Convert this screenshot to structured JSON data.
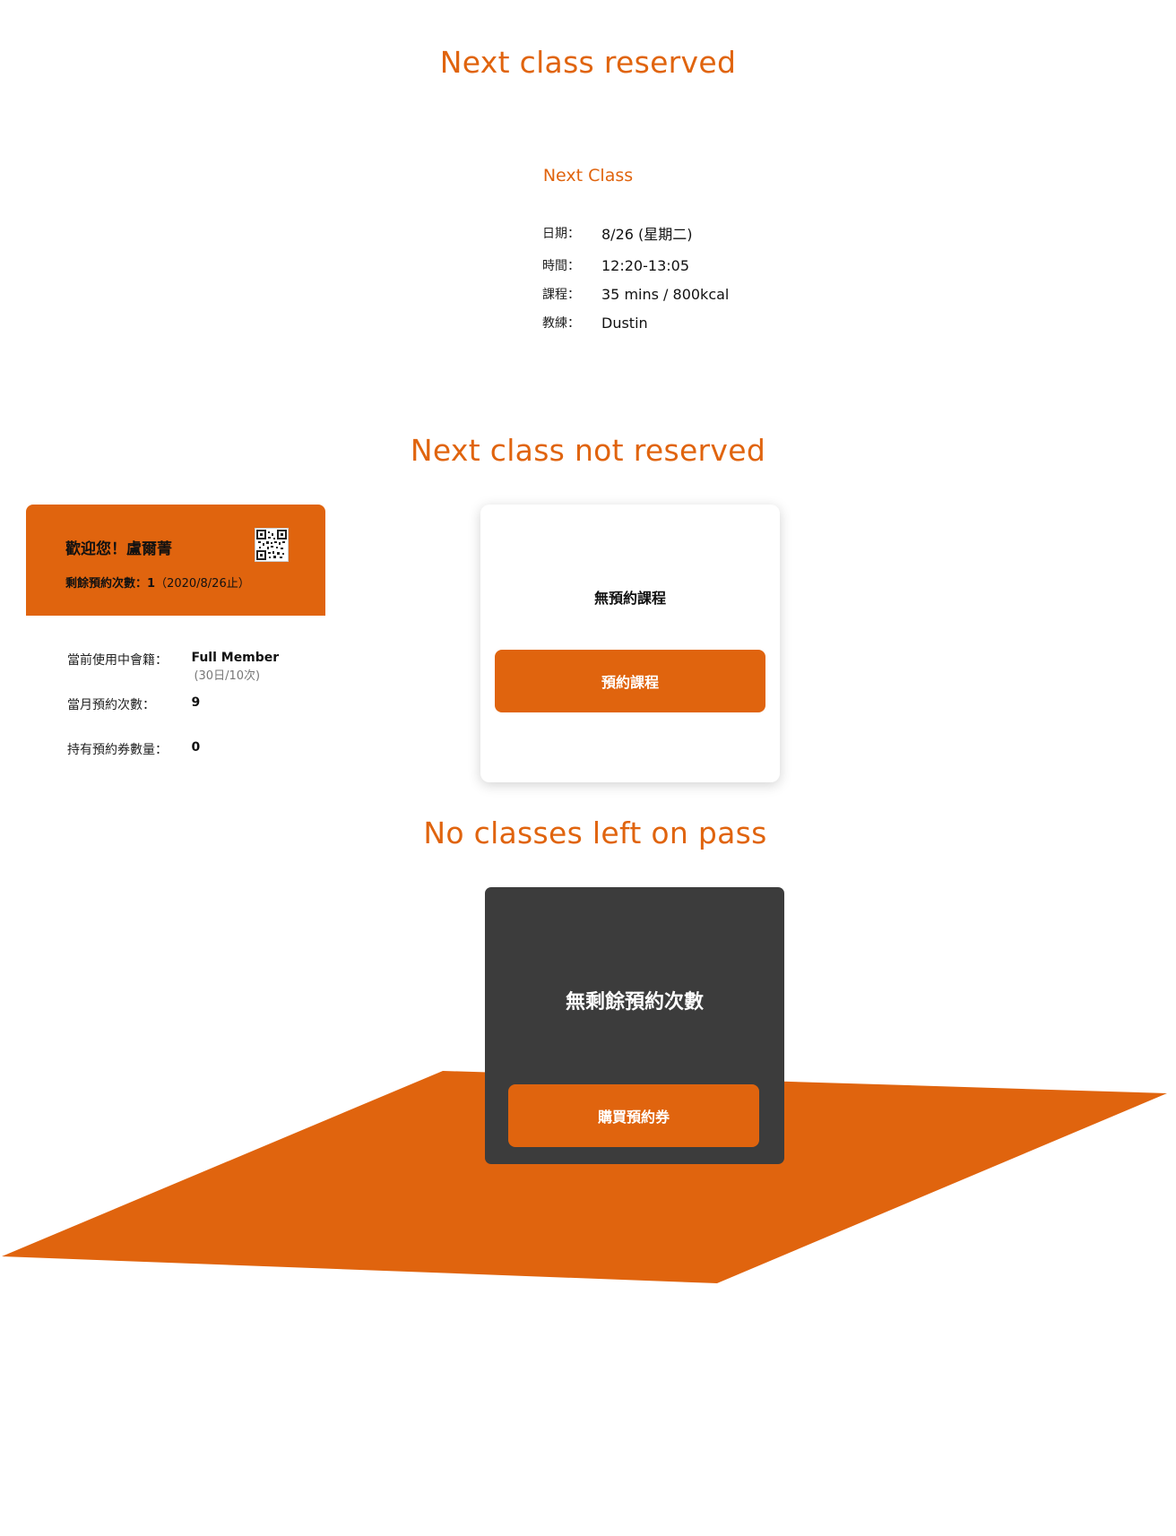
{
  "sections": {
    "reserved_title": "Next class reserved",
    "not_reserved_title": "Next class not reserved",
    "no_classes_title": "No classes left on pass"
  },
  "next_class": {
    "label": "Next Class",
    "rows": [
      {
        "key": "日期：",
        "value": "8/26 (星期二)"
      },
      {
        "key": "時間：",
        "value": "12:20-13:05"
      },
      {
        "key": "課程：",
        "value": "35 mins / 800kcal"
      },
      {
        "key": "教練：",
        "value": "Dustin"
      }
    ]
  },
  "member": {
    "welcome": "歡迎您！盧爾菁",
    "remaining_label": "剩餘預約次數：",
    "remaining_value": "1",
    "remaining_until": "（2020/8/26止）",
    "qr_icon": "qr-code-icon",
    "info": [
      {
        "key": "當前使用中會籍：",
        "value": "Full Member",
        "sub": "(30日/10次)"
      },
      {
        "key": "當月預約次數：",
        "value": "9"
      },
      {
        "key": "持有預約券數量：",
        "value": "0"
      }
    ]
  },
  "not_reserved_card": {
    "message": "無預約課程",
    "button_label": "預約課程"
  },
  "no_classes_card": {
    "message": "無剩餘預約次數",
    "button_label": "購買預約券"
  },
  "colors": {
    "accent": "#e0640e",
    "dark_card": "#3c3c3c"
  }
}
